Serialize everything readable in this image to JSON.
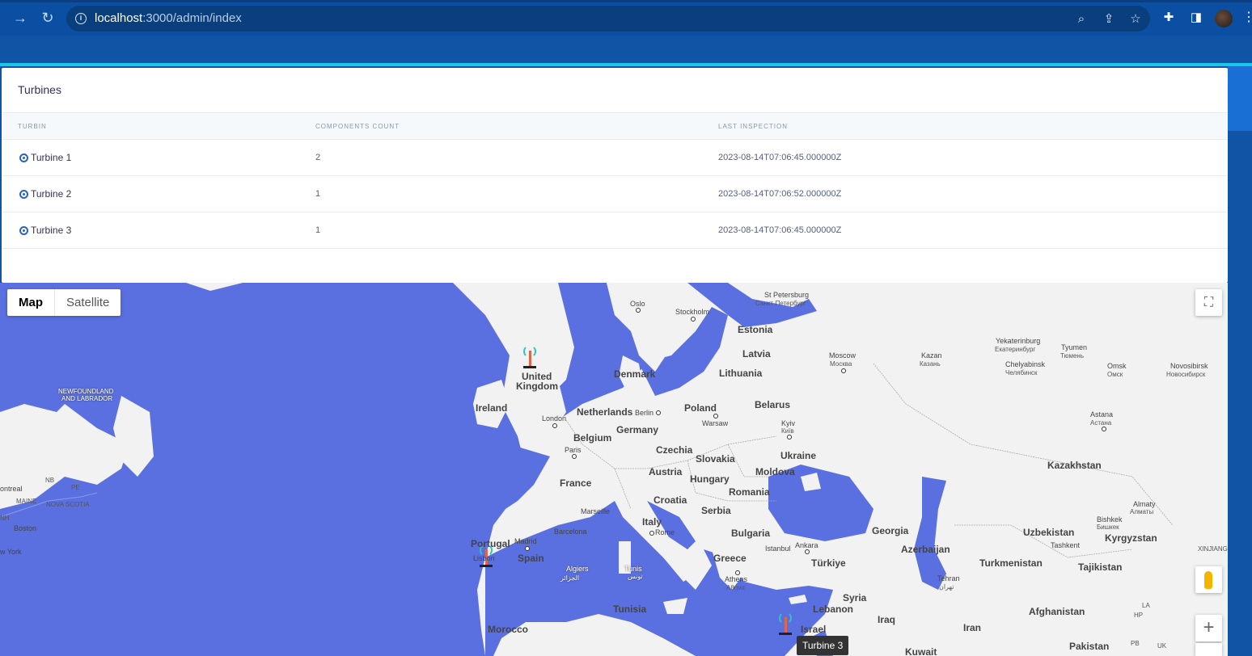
{
  "browser": {
    "url_host": "localhost",
    "url_path": ":3000/admin/index"
  },
  "card": {
    "title": "Turbines",
    "columns": [
      "Turbin",
      "Components count",
      "Last inspection"
    ],
    "rows": [
      {
        "name": "Turbine 1",
        "components": "2",
        "last_inspection": "2023-08-14T07:06:45.000000Z"
      },
      {
        "name": "Turbine 2",
        "components": "1",
        "last_inspection": "2023-08-14T07:06:52.000000Z"
      },
      {
        "name": "Turbine 3",
        "components": "1",
        "last_inspection": "2023-08-14T07:06:45.000000Z"
      }
    ]
  },
  "map": {
    "type_buttons": {
      "map": "Map",
      "satellite": "Satellite"
    },
    "tooltip": "Turbine 3",
    "labels": {
      "ireland": "Ireland",
      "uk1": "United",
      "uk2": "Kingdom",
      "london": "London",
      "netherlands": "Netherlands",
      "berlin": "Berlin",
      "belgium": "Belgium",
      "germany": "Germany",
      "paris": "Paris",
      "france": "France",
      "poland": "Poland",
      "warsaw": "Warsaw",
      "czechia": "Czechia",
      "slovakia": "Slovakia",
      "austria": "Austria",
      "hungary": "Hungary",
      "belarus": "Belarus",
      "kyiv": "Kyiv",
      "kyiv_cyr": "Київ",
      "ukraine": "Ukraine",
      "moldova": "Moldova",
      "romania": "Romania",
      "croatia": "Croatia",
      "serbia": "Serbia",
      "bulgaria": "Bulgaria",
      "italy": "Italy",
      "rome": "Rome",
      "marseille": "Marseille",
      "barcelona": "Barcelona",
      "madrid": "Madrid",
      "spain": "Spain",
      "portugal": "Portugal",
      "lisbon": "Lisbon",
      "algiers": "Algiers",
      "algiers_ar": "الجزائر",
      "tunis": "Tunis",
      "tunis_ar": "تونس",
      "tunisia": "Tunisia",
      "morocco": "Morocco",
      "greece": "Greece",
      "athens": "Athens",
      "athens_gr": "Αθήνα",
      "istanbul": "Istanbul",
      "ankara": "Ankara",
      "turkiye": "Türkiye",
      "syria": "Syria",
      "lebanon": "Lebanon",
      "israel": "Israel",
      "iraq": "Iraq",
      "iran": "Iran",
      "tehran": "Tehran",
      "tehran_fa": "تهران",
      "kuwait": "Kuwait",
      "georgia": "Georgia",
      "azerbaijan": "Azerbaijan",
      "turkmenistan": "Turkmenistan",
      "uzbekistan": "Uzbekistan",
      "tashkent": "Tashkent",
      "tajikistan": "Tajikistan",
      "kyrgyzstan": "Kyrgyzstan",
      "bishkek": "Bishkek",
      "bishkek_cyr": "Бишкек",
      "afghanistan": "Afghanistan",
      "pakistan": "Pakistan",
      "kazakhstan": "Kazakhstan",
      "astana": "Astana",
      "astana_cyr": "Астана",
      "almaty": "Almaty",
      "almaty_cyr": "Алматы",
      "denmark": "Denmark",
      "oslo": "Oslo",
      "stockholm": "Stockholm",
      "estonia": "Estonia",
      "latvia": "Latvia",
      "lithuania": "Lithuania",
      "stpete": "St Petersburg",
      "stpete_cyr": "Санкт-Петербург",
      "moscow": "Moscow",
      "moscow_cyr": "Москва",
      "kazan": "Kazan",
      "kazan_cyr": "Казань",
      "yekat": "Yekaterinburg",
      "yekat_cyr": "Екатеринбург",
      "tyumen": "Tyumen",
      "tyumen_cyr": "Тюмень",
      "chelyabinsk": "Chelyabinsk",
      "chelyabinsk_cyr": "Челябинск",
      "omsk": "Omsk",
      "omsk_cyr": "Омск",
      "novosibirsk": "Novosibirsk",
      "novosibirsk_cyr": "Новосибирск",
      "newfoundland1": "NEWFOUNDLAND",
      "newfoundland2": "AND LABRADOR",
      "nb": "NB",
      "pe": "PE",
      "maine": "MAINE",
      "nova_scotia": "NOVA SCOTIA",
      "montreal": "ontreal",
      "boston": "Boston",
      "new_york": "w York",
      "xinjiang": "XINJIANG",
      "hp": "HP",
      "pb": "PB",
      "uk": "UK",
      "la": "LA",
      "nh": "NH"
    }
  },
  "colors": {
    "water": "#5b70e0",
    "land": "#f2f2f2",
    "header": "#1055a5",
    "accent": "#19c7e8"
  }
}
